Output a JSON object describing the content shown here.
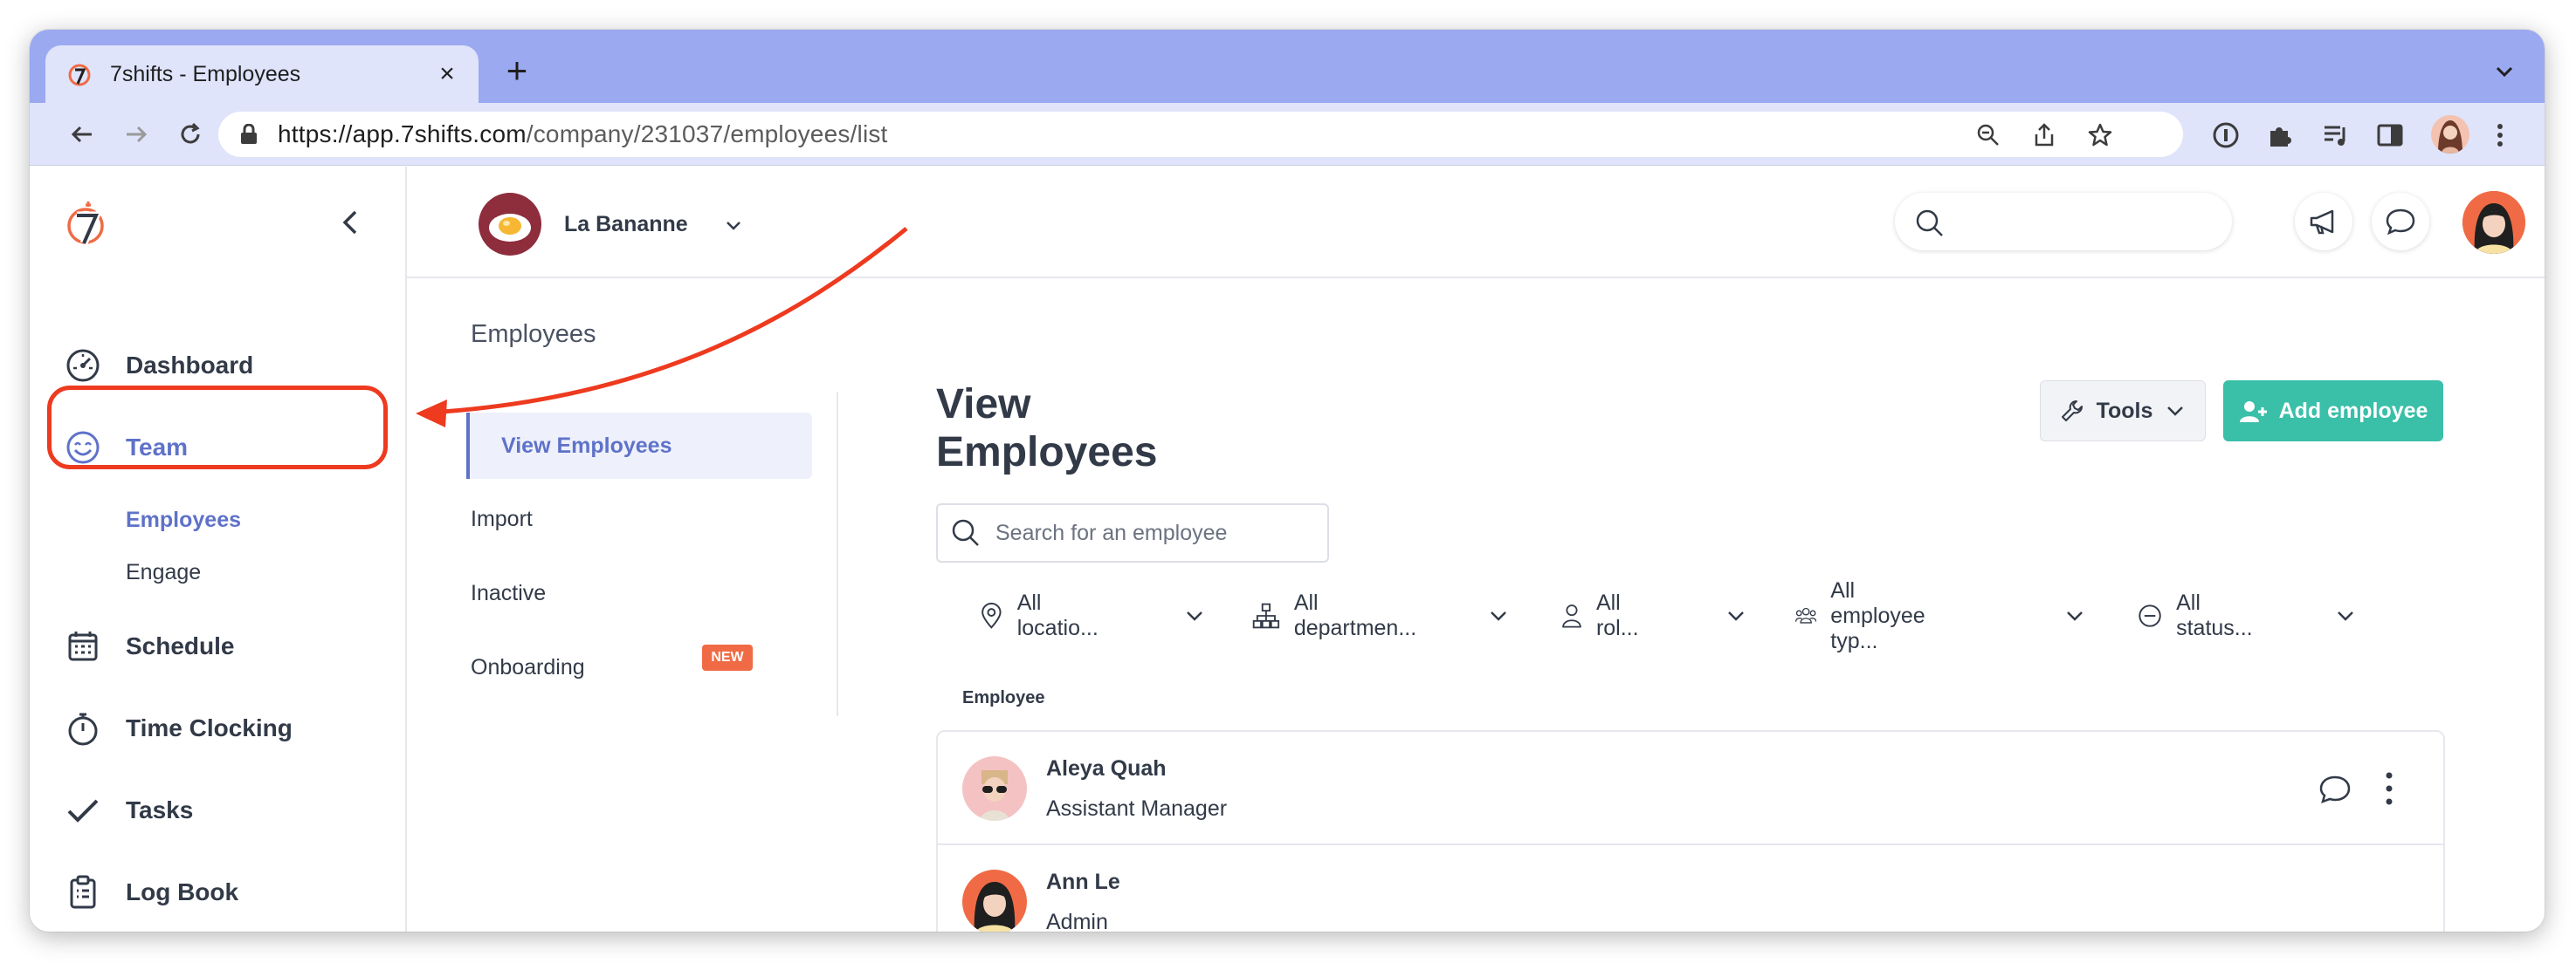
{
  "browser": {
    "tab_title": "7shifts - Employees",
    "tab_close": "×",
    "new_tab": "+",
    "url_domain": "https://app.7shifts.com",
    "url_path": "/company/231037/employees/list"
  },
  "sidebar": {
    "items": [
      {
        "label": "Dashboard",
        "icon": "gauge-icon"
      },
      {
        "label": "Team",
        "icon": "smile-icon"
      },
      {
        "label": "Schedule",
        "icon": "calendar-icon"
      },
      {
        "label": "Time Clocking",
        "icon": "stopwatch-icon"
      },
      {
        "label": "Tasks",
        "icon": "checkmark-icon"
      },
      {
        "label": "Log Book",
        "icon": "clipboard-icon"
      }
    ],
    "team_sub": [
      "Employees",
      "Engage"
    ]
  },
  "topbar": {
    "location_name": "La Bananne"
  },
  "subnav": {
    "title": "Employees",
    "items": [
      "View Employees",
      "Import",
      "Inactive",
      "Onboarding"
    ],
    "new_badge": "NEW"
  },
  "main": {
    "page_title": "View Employees",
    "tools_label": "Tools",
    "add_label": "Add employee",
    "search_placeholder": "Search for an employee",
    "filters": [
      {
        "label": "All locatio...",
        "icon": "pin-icon"
      },
      {
        "label": "All departmen...",
        "icon": "org-icon"
      },
      {
        "label": "All rol...",
        "icon": "person-icon"
      },
      {
        "label": "All employee typ...",
        "icon": "people-icon"
      },
      {
        "label": "All status...",
        "icon": "minus-circle-icon"
      }
    ],
    "column_header": "Employee",
    "employees": [
      {
        "name": "Aleya Quah",
        "role": "Assistant Manager"
      },
      {
        "name": "Ann Le",
        "role": "Admin"
      }
    ]
  },
  "colors": {
    "accent": "#5f72c9",
    "primary_button": "#3abfa8",
    "annotation": "#ee3a1f",
    "badge": "#f06b45"
  }
}
